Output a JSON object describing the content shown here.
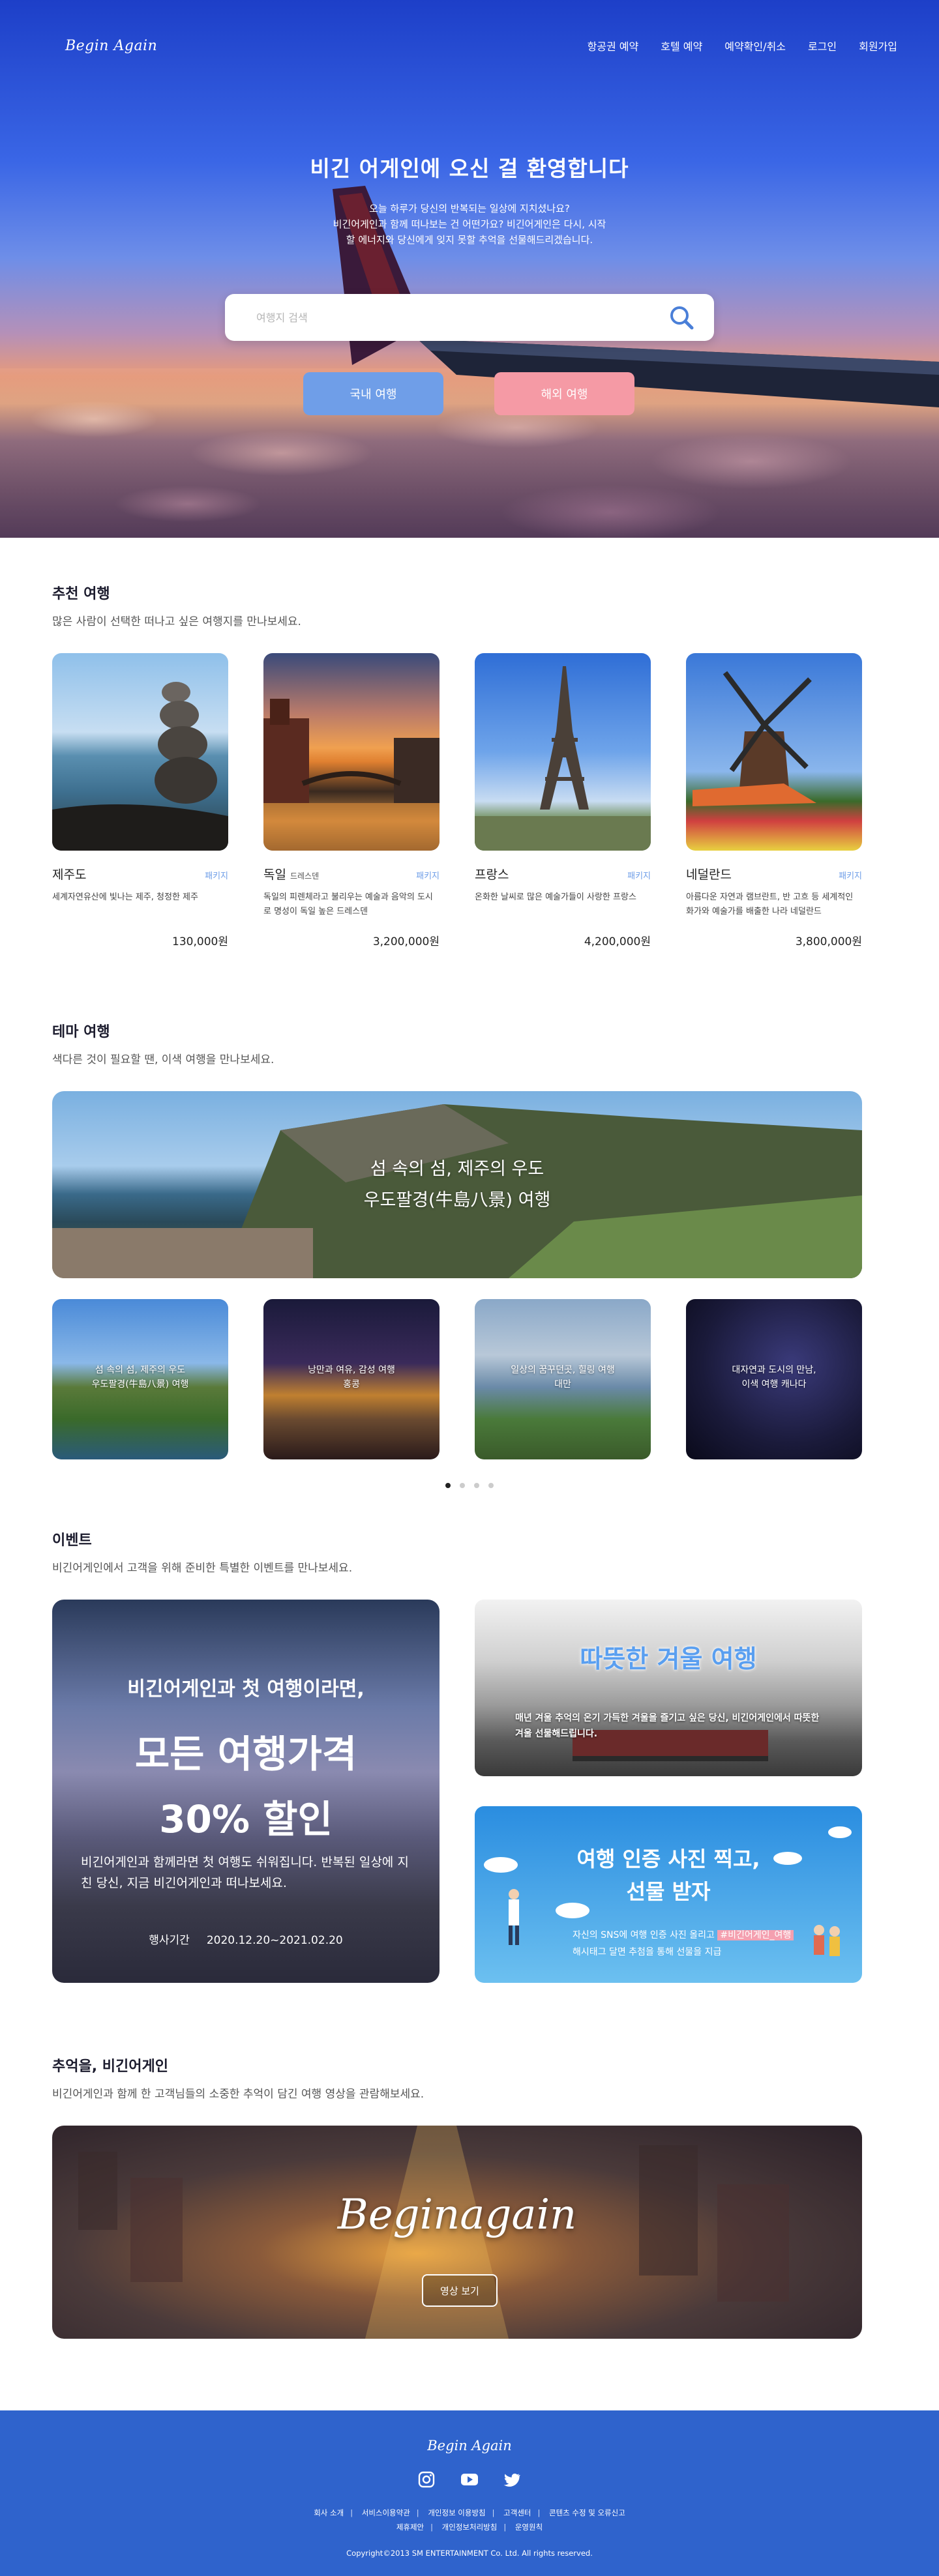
{
  "nav": {
    "logo": "Begin Again",
    "menu": [
      "항공권 예약",
      "호텔 예약",
      "예약확인/취소",
      "로그인",
      "회원가입"
    ]
  },
  "hero": {
    "title": "비긴 어게인에 오신 걸 환영합니다",
    "subtitle": "오늘 하루가 당신의 반복되는 일상에 지치셨나요?\n비긴어게인과 함께 떠나보는 건 어떤가요? 비긴어게인은 다시, 시작\n할 에너지와 당신에게 잊지 못할 추억을 선물해드리겠습니다.",
    "search_placeholder": "여행지 검색",
    "btn_domestic": "국내 여행",
    "btn_abroad": "해외 여행"
  },
  "recommend": {
    "title": "추천 여행",
    "subtitle": "많은 사람이 선택한 떠나고 싶은 여행지를 만나보세요.",
    "items": [
      {
        "name": "제주도",
        "sub": "",
        "tag": "패키지",
        "desc": "세계자연유산에 빛나는 제주, 청정한 제주",
        "price": "130,000원"
      },
      {
        "name": "독일",
        "sub": "드레스덴",
        "tag": "패키지",
        "desc": "독일의 피렌체라고 불리우는 예술과 음악의 도시로 명성이 독일 높은 드레스덴",
        "price": "3,200,000원"
      },
      {
        "name": "프랑스",
        "sub": "",
        "tag": "패키지",
        "desc": "온화한 날씨로 많은 예술가들이 사랑한 프랑스",
        "price": "4,200,000원"
      },
      {
        "name": "네덜란드",
        "sub": "",
        "tag": "패키지",
        "desc": "아름다운 자연과 램브란트, 반 고흐 등 세계적인 화가와 예술가를 배출한 나라 네덜란드",
        "price": "3,800,000원"
      }
    ]
  },
  "theme": {
    "title": "테마 여행",
    "subtitle": "색다른 것이 필요할 땐, 이색 여행을 만나보세요.",
    "big_line1": "섬 속의 섬, 제주의 우도",
    "big_line2": "우도팔경(牛島八景) 여행",
    "cards": [
      "섬 속의 섬, 제주의 우도\n우도팔경(牛島八景) 여행",
      "낭만과 여유, 감성 여행\n홍콩",
      "일상의 꿈꾸던곳, 힐링 여행\n대만",
      "대자연과 도시의 만남,\n이색 여행 캐나다"
    ]
  },
  "event": {
    "title": "이벤트",
    "subtitle": "비긴어게인에서 고객을 위해 준비한 특별한 이벤트를 만나보세요.",
    "main": {
      "line1": "비긴어게인과 첫 여행이라면,",
      "line2": "모든 여행가격",
      "line3": "30% 할인",
      "line4": "비긴어게인과 함께라면 첫 여행도 쉬워집니다. 반복된 일상에 지친 당신, 지금 비긴어게인과 떠나보세요.",
      "period_label": "행사기간",
      "period": "2020.12.20~2021.02.20"
    },
    "side1": {
      "title": "따뜻한 겨울 여행",
      "desc": "매년 겨울 추억의 온기 가득한 겨울을 즐기고 싶은 당신, 비긴어게인에서 따뜻한 겨울 선물해드립니다."
    },
    "side2": {
      "title": "여행 인증 사진 찍고,\n선물 받자",
      "desc1": "자신의 SNS에 여행 인증 사진 올리고",
      "hashtag": "#비긴어게인_여행",
      "desc2": "해시태그 달면 추첨을 통해 선물을 지급"
    }
  },
  "memory": {
    "title": "추억을, 비긴어게인",
    "subtitle": "비긴어게인과 함께 한 고객님들의 소중한 추억이 담긴 여행 영상을 관람해보세요.",
    "video_logo": "Beginagain",
    "video_btn": "영상 보기"
  },
  "footer": {
    "logo": "Begin Again",
    "links_row1": [
      "회사 소개",
      "서비스이용약관",
      "개인정보 이용방침",
      "고객센터",
      "콘텐츠 수정 및 오류신고"
    ],
    "links_row2": [
      "제휴제안",
      "개인정보처리방침",
      "운영원칙"
    ],
    "copyright": "Copyright©2013 SM ENTERTAINMENT Co. Ltd. All rights reserved."
  },
  "colors": {
    "accent_blue": "#6f9ee8",
    "accent_pink": "#f59aa5",
    "footer_bg": "#2f63cc"
  }
}
